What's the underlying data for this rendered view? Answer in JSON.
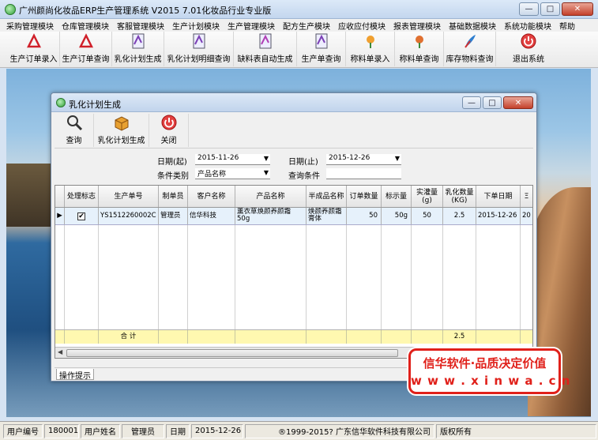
{
  "window": {
    "title": "广州颜尚化妆品ERP生产管理系统  V2015  7.01化妆品行业专业版"
  },
  "menu": [
    "采购管理模块",
    "仓库管理模块",
    "客服管理模块",
    "生产计划模块",
    "生产管理模块",
    "配方生产模块",
    "应收应付模块",
    "报表管理模块",
    "基础数据模块",
    "系统功能模块",
    "帮助"
  ],
  "toolbar": [
    {
      "label": "生产订单录入",
      "icon": "pdf-icon"
    },
    {
      "label": "生产订单查询",
      "icon": "pdf-icon"
    },
    {
      "label": "乳化计划生成",
      "icon": "document-icon"
    },
    {
      "label": "乳化计划明细查询",
      "icon": "document-icon"
    },
    {
      "label": "缺料表自动生成",
      "icon": "document-icon"
    },
    {
      "label": "生产单查询",
      "icon": "document-icon"
    },
    {
      "label": "称料单录入",
      "icon": "flower-icon"
    },
    {
      "label": "称料单查询",
      "icon": "flower-icon"
    },
    {
      "label": "库存物料查询",
      "icon": "feather-icon"
    },
    {
      "label": "退出系统",
      "icon": "exit-icon"
    }
  ],
  "child": {
    "title": "乳化计划生成",
    "toolbar": [
      {
        "label": "查询",
        "icon": "search-icon"
      },
      {
        "label": "乳化计划生成",
        "icon": "box-icon"
      },
      {
        "label": "关闭",
        "icon": "close-circle-icon"
      }
    ],
    "filters": {
      "date_from_label": "日期(起)",
      "date_from": "2015-11-26",
      "date_to_label": "日期(止)",
      "date_to": "2015-12-26",
      "condition_type_label": "条件类别",
      "condition_type": "产品名称",
      "query_condition_label": "查询条件",
      "query_condition": ""
    },
    "grid": {
      "columns": [
        "处理标志",
        "生产单号",
        "制单员",
        "客户名称",
        "产品名称",
        "半成品名称",
        "订单数量",
        "标示量",
        "实灌量(g)",
        "乳化数量(KG)",
        "下单日期",
        "Ξ"
      ],
      "rows": [
        {
          "checked": true,
          "order_no": "YS1512260002C",
          "maker": "管理员",
          "customer": "信华科技",
          "product": "薰衣草焕颜养颜霜 50g",
          "semi_product": "焕颜养颜霜膏体",
          "order_qty": "50",
          "label_qty": "50g",
          "fill_qty": "50",
          "emulsion_kg": "2.5",
          "order_date": "2015-12-26",
          "extra": "20"
        }
      ],
      "footer": {
        "label": "合 计",
        "emulsion_kg": "2.5"
      }
    },
    "ops_tab": "操作提示"
  },
  "promo": {
    "line1": "信华软件·品质决定价值",
    "line2": "w w w . x i n w a . c n"
  },
  "status": {
    "user_no_label": "用户编号",
    "user_no": "180001",
    "user_name_label": "用户姓名",
    "user_name": "管理员",
    "date_label": "日期",
    "date": "2015-12-26",
    "copyright": "®1999-2015?  广东信华软件科技有限公司",
    "rights": "版权所有"
  },
  "colors": {
    "promo_red": "#e0201a",
    "row_highlight": "#e6f1fb",
    "footer_yellow": "#fff8b0"
  }
}
